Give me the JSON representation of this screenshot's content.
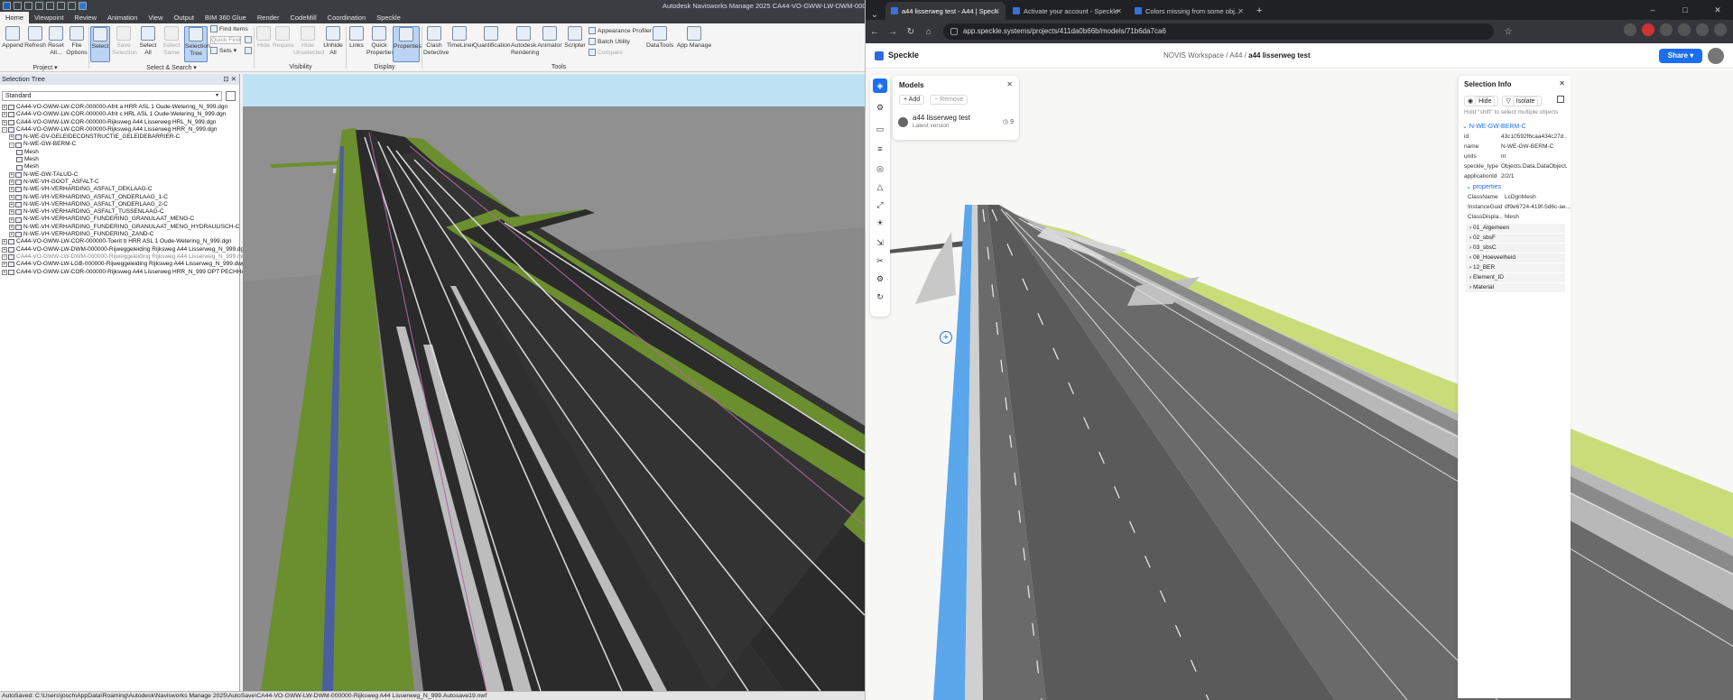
{
  "navisworks": {
    "title": "Autodesk Navisworks Manage 2025   CA44-VO-GWW-LW-DWM-000000-Ri...",
    "menu": [
      "Home",
      "Viewpoint",
      "Review",
      "Animation",
      "View",
      "Output",
      "BIM 360 Glue",
      "Render",
      "CodeMill",
      "Coordination",
      "Speckle"
    ],
    "ribbon": {
      "append": "Append",
      "refresh": "Refresh",
      "reset": "Reset All...",
      "file_options": "File Options",
      "select": "Select",
      "save_selection": "Save Selection",
      "select_all": "Select All",
      "select_same": "Select Same",
      "selection_tree": "Selection Tree",
      "find_items": "Find Items",
      "quick_find": "Quick Find",
      "sets": "Sets",
      "hide": "Hide",
      "require": "Require",
      "hide_unselected": "Hide Unselected",
      "unhide_all": "Unhide All",
      "links": "Links",
      "quick_properties": "Quick Properties",
      "properties": "Properties",
      "clash_detective": "Clash Detective",
      "timeliner": "TimeLiner",
      "quantification": "Quantification",
      "autodesk_rendering": "Autodesk Rendering",
      "animator": "Animator",
      "scripter": "Scripter",
      "appearance_profiler": "Appearance Profiler",
      "batch_utility": "Batch Utility",
      "compare": "Compare",
      "datatools": "DataTools",
      "app_manager": "App Manage",
      "groups": {
        "project": "Project",
        "select_search": "Select & Search",
        "visibility": "Visibility",
        "display": "Display",
        "tools": "Tools"
      }
    },
    "selection_tree": {
      "title": "Selection Tree",
      "mode": "Standard",
      "items": [
        {
          "text": "CA44-VO-GWW-LW-COR-000000-Afrit a HRR ASL 1 Oude-Wetering_N_999.dgn",
          "level": 0,
          "gray": false
        },
        {
          "text": "CA44-VO-GWW-LW-COR-000000-Afrit c HRL ASL 1 Oude-Wetering_N_999.dgn",
          "level": 0,
          "gray": false
        },
        {
          "text": "CA44-VO-GWW-LW-COR-000000-Rijksweg A44 Lisserweg HRL_N_999.dgn",
          "level": 0,
          "gray": false
        },
        {
          "text": "CA44-VO-GWW-LW-COR-000000-Rijksweg A44 Lisserweg HRR_N_999.dgn",
          "level": 0,
          "gray": false
        },
        {
          "text": "N-WE-GV-GELEIDECONSTRUCTIE_GELEIDEBARRIER-C",
          "level": 1,
          "gray": false
        },
        {
          "text": "N-WE-GW-BERM-C",
          "level": 1,
          "gray": false
        },
        {
          "text": "Mesh",
          "level": 2,
          "gray": false
        },
        {
          "text": "Mesh",
          "level": 2,
          "gray": false
        },
        {
          "text": "Mesh",
          "level": 2,
          "gray": false
        },
        {
          "text": "N-WE-GW-TALUD-C",
          "level": 1,
          "gray": false
        },
        {
          "text": "N-WE-VH-GOOT_ASFALT-C",
          "level": 1,
          "gray": false
        },
        {
          "text": "N-WE-VH-VERHARDING_ASFALT_DEKLAAG-C",
          "level": 1,
          "gray": false
        },
        {
          "text": "N-WE-VH-VERHARDING_ASFALT_ONDERLAAG_1-C",
          "level": 1,
          "gray": false
        },
        {
          "text": "N-WE-VH-VERHARDING_ASFALT_ONDERLAAG_2-C",
          "level": 1,
          "gray": false
        },
        {
          "text": "N-WE-VH-VERHARDING_ASFALT_TUSSENLAAG-C",
          "level": 1,
          "gray": false
        },
        {
          "text": "N-WE-VH-VERHARDING_FUNDERING_GRANULAAT_MENG-C",
          "level": 1,
          "gray": false
        },
        {
          "text": "N-WE-VH-VERHARDING_FUNDERING_GRANULAAT_MENG_HYDRAULISCH-C",
          "level": 1,
          "gray": false
        },
        {
          "text": "N-WE-VH-VERHARDING_FUNDERING_ZAND-C",
          "level": 1,
          "gray": false
        },
        {
          "text": "CA44-VO-GWW-LW-COR-000000-Toerit b HRR ASL 1 Oude-Wetering_N_999.dgn",
          "level": 0,
          "gray": false
        },
        {
          "text": "CA44-VO-GWW-LW-DWM-000000-Rijweggeleiding Rijksweg A44 Lisserweg_N_999.dgn",
          "level": 0,
          "gray": false
        },
        {
          "text": "CA44-VO-GWW-LW-DWM-000000-Rijweggeleiding Rijksweg A44 Lisserweg_N_999.nwc",
          "level": 0,
          "gray": true
        },
        {
          "text": "CA44-VO-GWW-LW-LGB-000000-Rijweggeleiding Rijksweg A44 Lisserweg_N_999.dwg",
          "level": 0,
          "gray": false
        },
        {
          "text": "CA44-VO-GWW-LW-COR-000000-Rijksweg A44 Lisserweg HRR_N_999 OPT PECHHAVEN.dgn",
          "level": 0,
          "gray": false
        }
      ]
    },
    "status": "AutoSaved: C:\\Users\\josch\\AppData\\Roaming\\Autodesk\\Navisworks Manage 2025\\AutoSave\\CA44-VO-GWW-LW-DWM-000000-Rijksweg A44 Lisserweg_N_999.Autosave19.nwf",
    "colors": {
      "grass": "#6b8e2f",
      "asphalt": "#2b2b2b",
      "sky": "#bfe3f5",
      "ground": "#8a8a8a",
      "median": "#bdbdbd"
    }
  },
  "browser": {
    "tabs": [
      {
        "label": "a44 lisserweg test - A44 | Speck",
        "active": true
      },
      {
        "label": "Activate your account - Speckle",
        "active": false
      },
      {
        "label": "Colors missing from some obj...",
        "active": false
      }
    ],
    "url": "app.speckle.systems/projects/411da0b66b/models/71b6da7ca6",
    "window_controls": [
      "–",
      "□",
      "✕"
    ]
  },
  "speckle": {
    "app": "Speckle",
    "breadcrumb": {
      "workspace": "NOVIS Workspace",
      "project": "A44",
      "model": "a44 lisserweg test"
    },
    "share": "Share",
    "models_panel": {
      "title": "Models",
      "add": "+ Add",
      "remove": "− Remove",
      "model_name": "a44 lisserweg test",
      "version": "Latest version",
      "count": "9"
    },
    "selection_info": {
      "title": "Selection Info",
      "hide": "Hide",
      "isolate": "Isolate",
      "hint": "Hold \"shift\" to select multiple objects",
      "object": "N-WE-GW-BERM-C",
      "fields": [
        {
          "k": "id",
          "v": "43c10592f6caa434c27d..."
        },
        {
          "k": "name",
          "v": "N-WE-GW-BERM-C"
        },
        {
          "k": "units",
          "v": "m"
        },
        {
          "k": "speckle_type",
          "v": "Objects.Data.DataObject..."
        },
        {
          "k": "applicationId",
          "v": "2/2/1"
        }
      ],
      "properties_label": "properties",
      "prop_fields": [
        {
          "k": "ClassName",
          "v": "LcDgnMesh"
        },
        {
          "k": "InstanceGuid",
          "v": "df9e6724-419f-5d6c-ae..."
        },
        {
          "k": "ClassDispla...",
          "v": "Mesh"
        }
      ],
      "groups": [
        "01_Algemeen",
        "02_sbsF",
        "03_sbsC",
        "08_Hoeveelheid",
        "12_BER",
        "Element_ID",
        "Material"
      ]
    },
    "colors": {
      "accent": "#1b6ff0",
      "highlight": "#5aa7ec",
      "verge": "#c9dc7a",
      "road": "#5a5a5a"
    }
  }
}
